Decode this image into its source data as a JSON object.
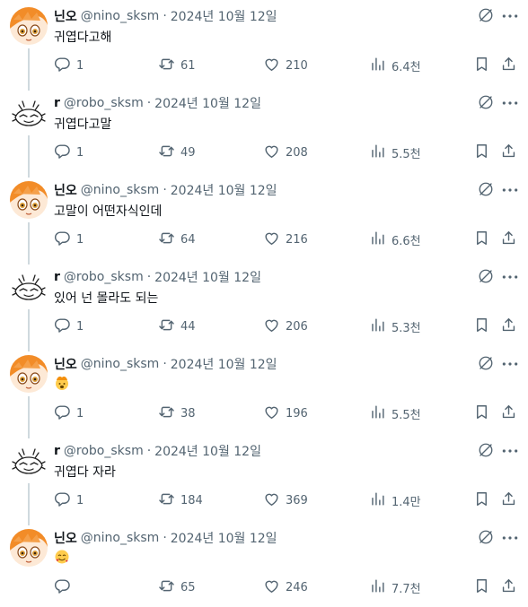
{
  "accent_colors": {
    "text": "#0f1419",
    "secondary": "#536471",
    "thread_line": "#cfd9de"
  },
  "tweets": [
    {
      "name": "닌오",
      "handle": "@nino_sksm",
      "date": "2024년 10월 12일",
      "text": "귀엽다고해",
      "avatar": "orange-hair-avatar",
      "replies": "1",
      "retweets": "61",
      "likes": "210",
      "views": "6.4천"
    },
    {
      "name": "r",
      "handle": "@robo_sksm",
      "date": "2024년 10월 12일",
      "text": "귀엽다고말",
      "avatar": "sketch-robot-avatar",
      "replies": "1",
      "retweets": "49",
      "likes": "208",
      "views": "5.5천"
    },
    {
      "name": "닌오",
      "handle": "@nino_sksm",
      "date": "2024년 10월 12일",
      "text": "고말이 어떤자식인데",
      "avatar": "orange-hair-avatar",
      "replies": "1",
      "retweets": "64",
      "likes": "216",
      "views": "6.6천"
    },
    {
      "name": "r",
      "handle": "@robo_sksm",
      "date": "2024년 10월 12일",
      "text": "있어 넌 몰라도 되는",
      "avatar": "sketch-robot-avatar",
      "replies": "1",
      "retweets": "44",
      "likes": "206",
      "views": "5.3천"
    },
    {
      "name": "닌오",
      "handle": "@nino_sksm",
      "date": "2024년 10월 12일",
      "text": "",
      "emoji": "exploding-head-emoji",
      "avatar": "orange-hair-avatar",
      "replies": "1",
      "retweets": "38",
      "likes": "196",
      "views": "5.5천"
    },
    {
      "name": "r",
      "handle": "@robo_sksm",
      "date": "2024년 10월 12일",
      "text": "귀엽다 자라",
      "avatar": "sketch-robot-avatar",
      "replies": "1",
      "retweets": "184",
      "likes": "369",
      "views": "1.4만"
    },
    {
      "name": "닌오",
      "handle": "@nino_sksm",
      "date": "2024년 10월 12일",
      "text": "",
      "emoji": "smiling-face-with-hearts-emoji",
      "avatar": "orange-hair-avatar",
      "replies": "",
      "retweets": "65",
      "likes": "246",
      "views": "7.7천"
    }
  ]
}
